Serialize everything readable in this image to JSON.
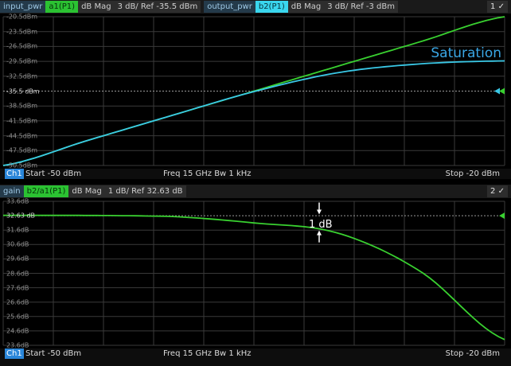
{
  "top_diagram": {
    "trace1": {
      "name": "input_pwr",
      "measurement": "a1(P1)",
      "format": "dB Mag",
      "scale": "3 dB/ Ref -35.5 dBm"
    },
    "trace2": {
      "name": "output_pwr",
      "measurement": "b2(P1)",
      "format": "dB Mag",
      "scale": "3 dB/ Ref -3 dBm"
    },
    "selector": "1 ✓",
    "y_labels": [
      "-20.5dBm",
      "-23.5dBm",
      "-26.5dBm",
      "-29.5dBm",
      "-32.5dBm",
      "-35.5 dBm",
      "-38.5dBm",
      "-41.5dBm",
      "-44.5dBm",
      "-47.5dBm",
      "-50.5dBm"
    ],
    "annotation": "Saturation",
    "footer": {
      "channel": "Ch1",
      "start": "Start  -50 dBm",
      "freq": "Freq  15 GHz  Bw  1 kHz",
      "stop": "Stop  -20 dBm"
    }
  },
  "bottom_diagram": {
    "trace": {
      "name": "gain",
      "measurement": "b2/a1(P1)",
      "format": "dB Mag",
      "scale": "1 dB/ Ref 32.63 dB"
    },
    "selector": "2 ✓",
    "y_labels": [
      "33.6dB",
      "32.63 dB",
      "31.6dB",
      "30.6dB",
      "29.6dB",
      "28.6dB",
      "27.6dB",
      "26.6dB",
      "25.6dB",
      "24.6dB",
      "23.6dB"
    ],
    "annotation": "1 dB",
    "footer": {
      "channel": "Ch1",
      "start": "Start  -50 dBm",
      "freq": "Freq  15 GHz  Bw  1 kHz",
      "stop": "Stop  -20 dBm"
    }
  },
  "colors": {
    "input_trace": "#39d030",
    "output_trace": "#3ac8e6",
    "gain_trace": "#39d030",
    "grid": "#3a3a3a",
    "saturation_text": "#3aa7e6"
  },
  "chart_data": [
    {
      "type": "line",
      "x": [
        -50,
        -45,
        -40,
        -35,
        -30,
        -25,
        -20
      ],
      "xlim": [
        -50,
        -20
      ],
      "ylim": [
        -50.5,
        -20.5
      ],
      "series": [
        {
          "name": "input_pwr",
          "values": [
            -50.5,
            -45.5,
            -40.5,
            -35.5,
            -30.5,
            -25.5,
            -20.5
          ]
        },
        {
          "name": "output_pwr",
          "values": [
            -50.5,
            -45.5,
            -40.5,
            -35.6,
            -31.8,
            -30.0,
            -29.4
          ]
        }
      ]
    },
    {
      "type": "line",
      "x": [
        -50,
        -40,
        -35,
        -30,
        -25,
        -20
      ],
      "xlim": [
        -50,
        -20
      ],
      "ylim": [
        23.6,
        33.6
      ],
      "series": [
        {
          "name": "gain",
          "values": [
            32.63,
            32.55,
            32.1,
            31.4,
            28.7,
            24.0
          ]
        }
      ]
    }
  ]
}
